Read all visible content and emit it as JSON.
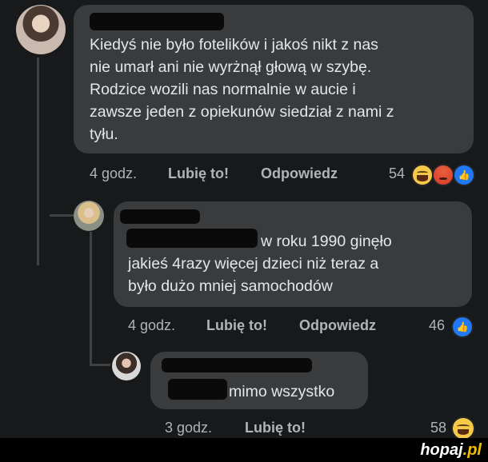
{
  "comments": [
    {
      "text": "Kiedyś nie było fotelików i jakoś nikt z nas\nnie umarł ani nie wyrżnął głową w szybę.\nRodzice wozili nas normalnie w aucie i\nzawsze jeden z opiekunów siedział z nami z\ntyłu.",
      "time": "4 godz.",
      "like_label": "Lubię to!",
      "reply_label": "Odpowiedz",
      "reaction_count": "54",
      "reactions": [
        "haha-icon",
        "angry-icon",
        "like-icon"
      ]
    },
    {
      "text": "w roku 1990 ginęło\njakieś 4razy więcej dzieci niż teraz a\nbyło dużo mniej samochodów",
      "time": "4 godz.",
      "like_label": "Lubię to!",
      "reply_label": "Odpowiedz",
      "reaction_count": "46",
      "reactions": [
        "like-icon"
      ]
    },
    {
      "text": "mimo wszystko",
      "time": "3 godz.",
      "like_label": "Lubię to!",
      "reaction_count": "58",
      "reactions": [
        "haha-icon"
      ]
    }
  ],
  "watermark": {
    "brand": "hopaj",
    "suffix": ".pl"
  },
  "colors": {
    "background": "#18191a",
    "bubble": "#3a3b3c",
    "like_blue": "#2078f4",
    "text": "#e4e6eb",
    "meta": "#b0b3b8"
  }
}
